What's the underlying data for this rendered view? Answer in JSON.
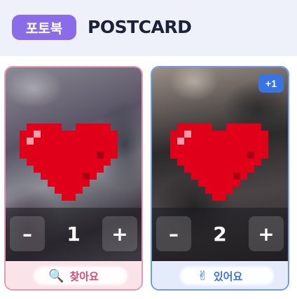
{
  "header": {
    "tag_label": "포토북",
    "title": "POSTCARD"
  },
  "cards": [
    {
      "quantity": "1",
      "minus_label": "–",
      "plus_label": "+",
      "footer_icon": "🔍",
      "footer_icon_name": "magnifier-icon",
      "footer_label": "찾아요",
      "accent": "#e0476e"
    },
    {
      "badge": "+1",
      "quantity": "2",
      "minus_label": "–",
      "plus_label": "+",
      "footer_icon": "✌",
      "footer_icon_name": "hand-icon",
      "footer_label": "있어요",
      "accent": "#3a74e0"
    }
  ]
}
